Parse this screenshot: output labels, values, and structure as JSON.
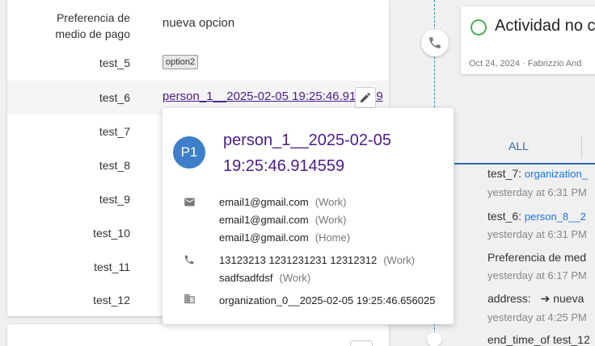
{
  "fields": [
    {
      "label_line1": "Preferencia de",
      "label_line2": "medio de pago",
      "value": "nueva opcion"
    },
    {
      "label": "test_5",
      "chip": "option2"
    },
    {
      "label": "test_6",
      "link": "person_1__2025-02-05 19:25:46.914559"
    },
    {
      "label": "test_7"
    },
    {
      "label": "test_8"
    },
    {
      "label": "test_9"
    },
    {
      "label": "test_10"
    },
    {
      "label": "test_11"
    },
    {
      "label": "test_12"
    }
  ],
  "popover": {
    "avatar": "P1",
    "name": "person_1__2025-02-05 19:25:46.914559",
    "emails": [
      {
        "value": "email1@gmail.com",
        "tag": "(Work)"
      },
      {
        "value": "email1@gmail.com",
        "tag": "(Work)"
      },
      {
        "value": "email1@gmail.com",
        "tag": "(Home)"
      }
    ],
    "phones": [
      {
        "value": "13123213 1231231231 12312312",
        "tag": "(Work)"
      },
      {
        "value": "sadfsadfdsf",
        "tag": "(Work)"
      }
    ],
    "organization": "organization_0__2025-02-05 19:25:46.656025"
  },
  "activity": {
    "title": "Actividad no c",
    "meta": "Oct 24, 2024 · Fabrizzio And"
  },
  "tabs": {
    "all": "ALL"
  },
  "history": [
    {
      "key": "test_7:",
      "value": "organization_",
      "time": "yesterday at 6:31 PM"
    },
    {
      "key": "test_6:",
      "value": "person_8__2",
      "time": "yesterday at 6:31 PM"
    },
    {
      "key": "Preferencia de med",
      "value": "",
      "time": "yesterday at 6:17 PM"
    },
    {
      "key": "address:",
      "value": "➔ nueva",
      "time": "yesterday at 4:25 PM"
    },
    {
      "key": "end_time_of test_12",
      "value": "",
      "time": ""
    }
  ],
  "icons": {
    "phone": "phone-icon",
    "edit": "pencil-icon",
    "email": "email-icon",
    "building": "building-icon"
  },
  "colors": {
    "link": "#4a1d8a",
    "avatar": "#3e7fc9",
    "accent": "#2b6cb0",
    "timeline": "#3a8fa8",
    "done": "#4caf50"
  }
}
